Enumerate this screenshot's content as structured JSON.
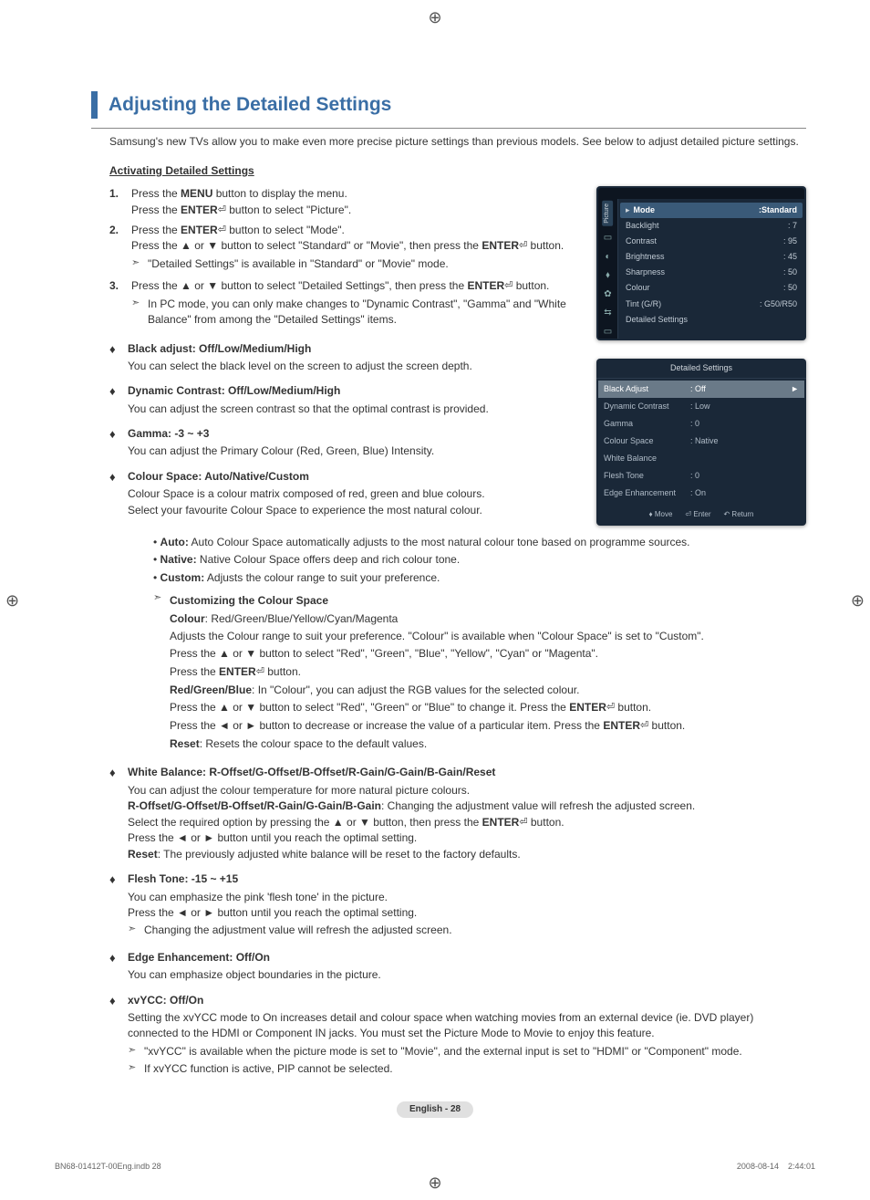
{
  "title": "Adjusting the Detailed Settings",
  "intro": "Samsung's new TVs allow you to make even more precise picture settings than previous models. See below to adjust detailed picture settings.",
  "subhead": "Activating Detailed Settings",
  "steps": {
    "s1a_pre": "Press the ",
    "s1a_menu": "MENU",
    "s1a_post": " button to display the menu.",
    "s1b_pre": "Press the ",
    "s1b_enter": "ENTER",
    "s1b_post": " button to select \"Picture\".",
    "s2a_pre": "Press the ",
    "s2a_enter": "ENTER",
    "s2a_post": " button to select \"Mode\".",
    "s2b": "Press the ▲ or ▼ button to select \"Standard\" or \"Movie\", then press the ",
    "s2b_enter": "ENTER",
    "s2b_post": " button.",
    "s2_note": "\"Detailed Settings\" is available in \"Standard\" or \"Movie\" mode.",
    "s3a": "Press the ▲ or ▼ button to select \"Detailed Settings\", then press the ",
    "s3a_enter": "ENTER",
    "s3a_post": " button.",
    "s3_note": "In PC mode, you can only make changes to \"Dynamic Contrast\", \"Gamma\" and \"White Balance\" from among the \"Detailed Settings\" items."
  },
  "bullets": {
    "black_title": "Black adjust: Off/Low/Medium/High",
    "black_body": "You can select the black level on the screen to adjust the screen depth.",
    "dyn_title": "Dynamic Contrast: Off/Low/Medium/High",
    "dyn_body": "You can adjust the screen contrast so that the optimal contrast is provided.",
    "gamma_title": "Gamma: -3 ~ +3",
    "gamma_body": "You can adjust the Primary Colour (Red, Green, Blue) Intensity.",
    "cspace_title": "Colour Space: Auto/Native/Custom",
    "cspace_body1": "Colour Space is a colour matrix composed of red, green and blue colours.",
    "cspace_body2": "Select your favourite Colour Space to experience the most natural colour.",
    "cspace_auto_pre": "Auto:",
    "cspace_auto": " Auto Colour Space automatically adjusts to the most natural colour tone based on programme sources.",
    "cspace_native_pre": "Native:",
    "cspace_native": " Native Colour Space offers deep and rich colour tone.",
    "cspace_custom_pre": "Custom:",
    "cspace_custom": " Adjusts the colour range to suit your preference.",
    "custom_head": "Customizing the Colour Space",
    "custom_l1_pre": "Colour",
    "custom_l1": ": Red/Green/Blue/Yellow/Cyan/Magenta",
    "custom_l2": "Adjusts the Colour range to suit your preference. \"Colour\" is available when \"Colour Space\" is set to \"Custom\".",
    "custom_l3": "Press the ▲ or ▼ button to select \"Red\", \"Green\", \"Blue\", \"Yellow\", \"Cyan\" or \"Magenta\".",
    "custom_l4_pre": "Press the ",
    "custom_l4_enter": "ENTER",
    "custom_l4_post": " button.",
    "custom_l5_pre": "Red/Green/Blue",
    "custom_l5": ": In \"Colour\", you can adjust the RGB values for the selected colour.",
    "custom_l6_pre": "Press the ▲ or ▼ button to select \"Red\", \"Green\" or \"Blue\" to change it. Press the ",
    "custom_l6_enter": "ENTER",
    "custom_l6_post": " button.",
    "custom_l7_pre": "Press the ◄ or ► button to decrease or increase the value of a particular item. Press the ",
    "custom_l7_enter": "ENTER",
    "custom_l7_post": " button.",
    "custom_l8_pre": "Reset",
    "custom_l8": ": Resets the colour space to the default values.",
    "wb_title": "White Balance: R-Offset/G-Offset/B-Offset/R-Gain/G-Gain/B-Gain/Reset",
    "wb_l1": "You can adjust the colour temperature for more natural picture colours.",
    "wb_l2_pre": "R-Offset/G-Offset/B-Offset/R-Gain/G-Gain/B-Gain",
    "wb_l2": ": Changing the adjustment value will refresh the adjusted screen.",
    "wb_l3_pre": "Select the required option by pressing the ▲ or ▼ button, then press the ",
    "wb_l3_enter": "ENTER",
    "wb_l3_post": " button.",
    "wb_l4": "Press the ◄ or ► button until you reach the optimal setting.",
    "wb_l5_pre": "Reset",
    "wb_l5": ": The previously adjusted white balance will be reset to the factory defaults.",
    "ft_title": "Flesh Tone: -15 ~ +15",
    "ft_l1": "You can emphasize the pink 'flesh tone' in the picture.",
    "ft_l2": "Press the ◄ or ► button until you reach the optimal setting.",
    "ft_note": "Changing the adjustment value will refresh the adjusted screen.",
    "edge_title": "Edge Enhancement: Off/On",
    "edge_body": "You can emphasize object boundaries in the picture.",
    "xv_title": "xvYCC: Off/On",
    "xv_body": "Setting the xvYCC mode to On increases detail and colour space when watching movies from an external device (ie. DVD player) connected to the HDMI or Component IN jacks. You must set the Picture Mode to Movie to enjoy this feature.",
    "xv_note1": "\"xvYCC\" is available when the picture mode is set to \"Movie\", and the external input is set to \"HDMI\" or \"Component\" mode.",
    "xv_note2": "If xvYCC function is active, PIP cannot be selected."
  },
  "osd1": {
    "tab": "Picture",
    "mode_label": "Mode",
    "mode_val": ":Standard",
    "rows": [
      {
        "label": "Backlight",
        "val": ": 7"
      },
      {
        "label": "Contrast",
        "val": ": 95"
      },
      {
        "label": "Brightness",
        "val": ": 45"
      },
      {
        "label": "Sharpness",
        "val": ": 50"
      },
      {
        "label": "Colour",
        "val": ": 50"
      },
      {
        "label": "Tint (G/R)",
        "val": ": G50/R50"
      },
      {
        "label": "Detailed Settings",
        "val": ""
      }
    ]
  },
  "osd2": {
    "title": "Detailed Settings",
    "rows": [
      {
        "label": "Black Adjust",
        "val": ": Off",
        "sel": true
      },
      {
        "label": "Dynamic Contrast",
        "val": ": Low"
      },
      {
        "label": "Gamma",
        "val": ": 0"
      },
      {
        "label": "Colour Space",
        "val": ": Native"
      },
      {
        "label": "White Balance",
        "val": ""
      },
      {
        "label": "Flesh Tone",
        "val": ": 0"
      },
      {
        "label": "Edge Enhancement",
        "val": ": On"
      }
    ],
    "footer": {
      "move": "Move",
      "enter": "Enter",
      "return": "Return"
    }
  },
  "page_label": "English - 28",
  "doc_footer_left": "BN68-01412T-00Eng.indb   28",
  "doc_footer_right": "2008-08-14      2:44:01"
}
